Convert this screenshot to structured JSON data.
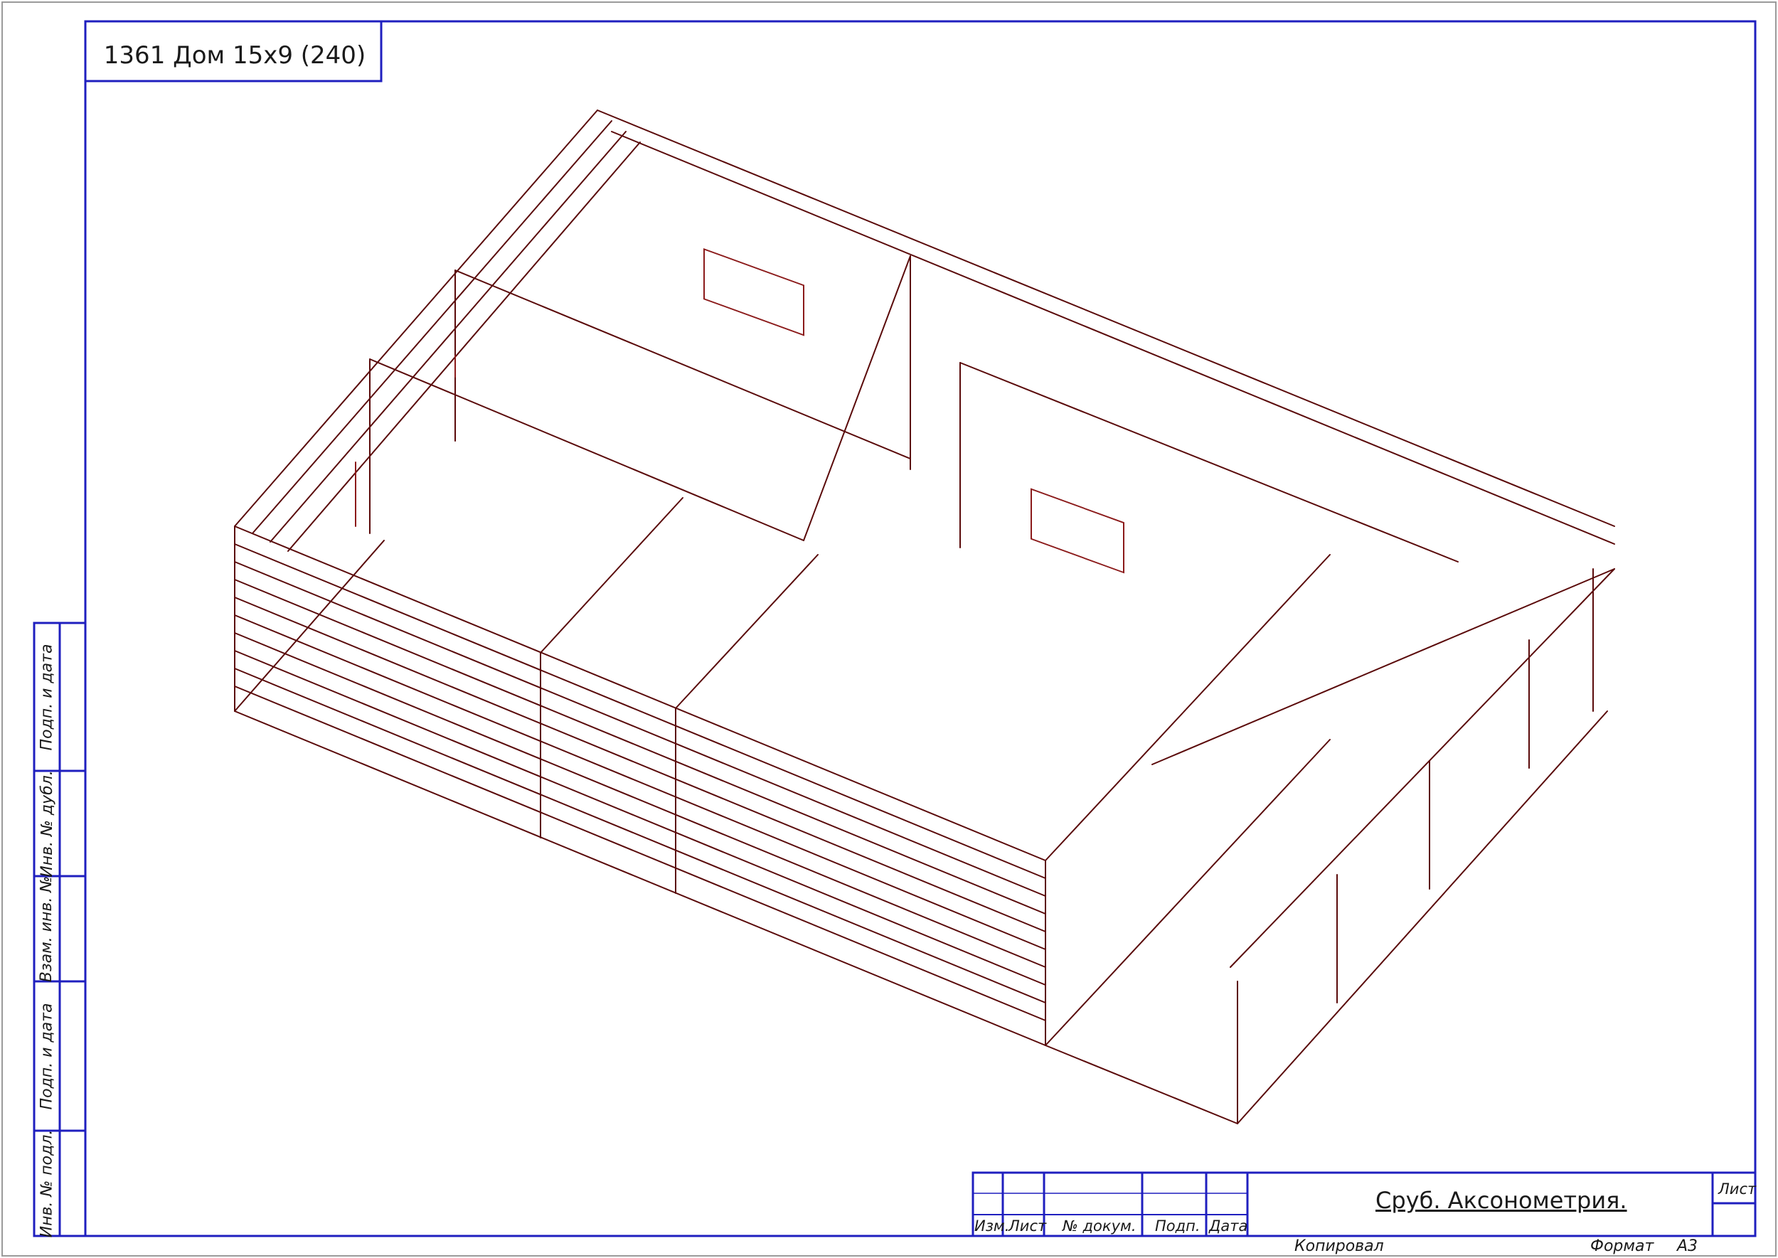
{
  "drawing_code": "1361 Дом 15х9 (240)",
  "side_stamp": [
    "Подп. и дата",
    "Инв. № дубл.",
    "Взам. инв. №",
    "Подп. и дата",
    "Инв. № подл."
  ],
  "title_block": {
    "columns": [
      "Изм.",
      "Лист",
      "№ докум.",
      "Подп.",
      "Дата"
    ],
    "sheet_title": "Сруб. Аксонометрия.",
    "sheet_label": "Лист"
  },
  "footer": {
    "copied": "Копировал",
    "format_label": "Формат",
    "format": "А3"
  },
  "colors": {
    "frame": "#1f1fbf",
    "model_line": "#5a0a0a",
    "opening": "#8b1a1a",
    "text": "#1a1a1a"
  }
}
